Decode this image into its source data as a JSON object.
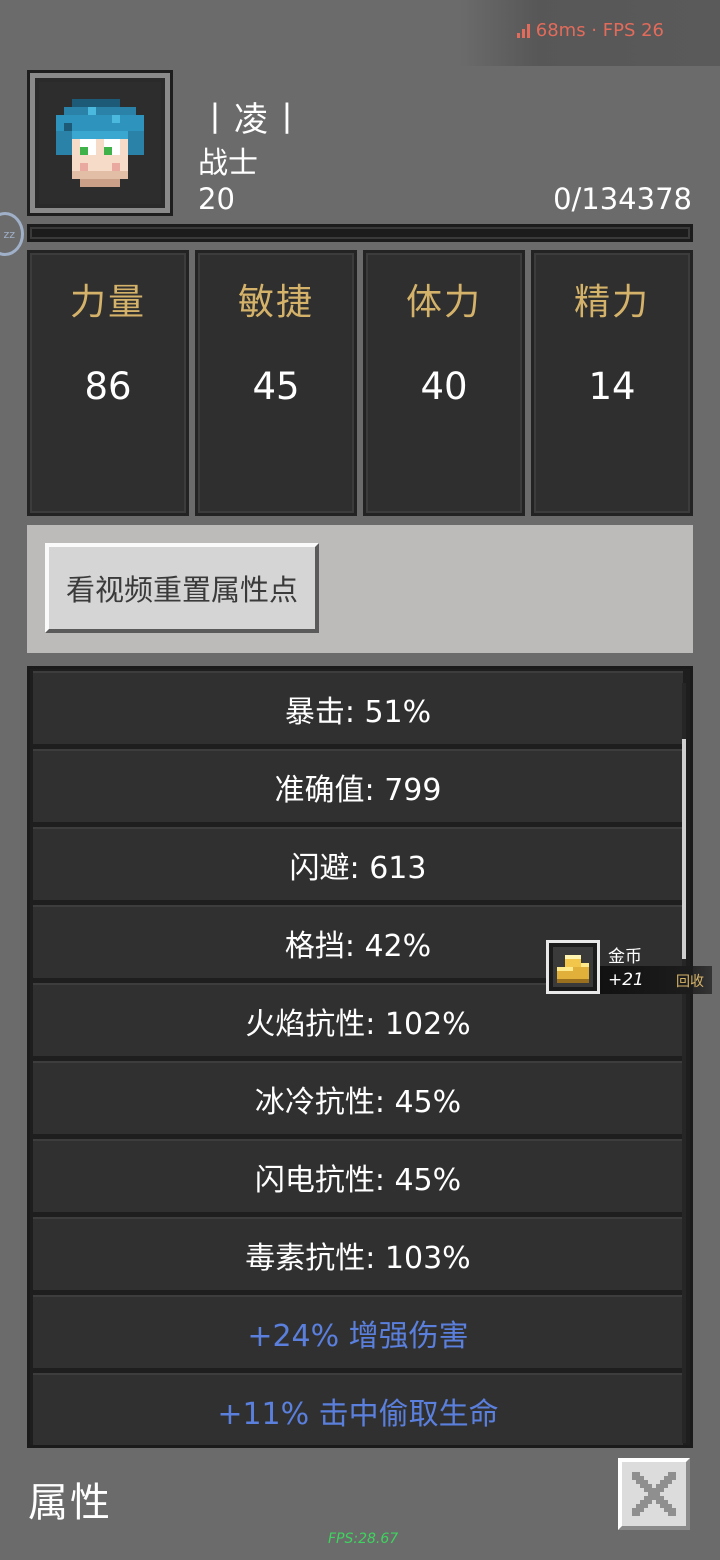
{
  "perf": {
    "text": "68ms · FPS 26",
    "icon": "signal-bars-icon",
    "color": "#e36b5b"
  },
  "character": {
    "name": "丨凌丨",
    "class": "战士",
    "level": "20",
    "exp": "0/134378",
    "exp_progress": 0
  },
  "side_bubble": {
    "text": "zz"
  },
  "stats": [
    {
      "name": "力量",
      "value": "86"
    },
    {
      "name": "敏捷",
      "value": "45"
    },
    {
      "name": "体力",
      "value": "40"
    },
    {
      "name": "精力",
      "value": "14"
    }
  ],
  "reset_button": {
    "label": "看视频重置属性点"
  },
  "attributes": [
    {
      "text": "暴击: 51%",
      "color": "white"
    },
    {
      "text": "准确值: 799",
      "color": "white"
    },
    {
      "text": "闪避: 613",
      "color": "white"
    },
    {
      "text": "格挡: 42%",
      "color": "white"
    },
    {
      "text": "火焰抗性: 102%",
      "color": "white"
    },
    {
      "text": "冰冷抗性: 45%",
      "color": "white"
    },
    {
      "text": "闪电抗性: 45%",
      "color": "white"
    },
    {
      "text": "毒素抗性: 103%",
      "color": "white"
    },
    {
      "text": "+24% 增强伤害",
      "color": "blue"
    },
    {
      "text": "+11% 击中偷取生命",
      "color": "blue"
    }
  ],
  "gold_popup": {
    "title": "金币",
    "amount": "+21",
    "action": "回收",
    "icon": "gold-coins-icon"
  },
  "footer": {
    "title": "属性",
    "close_icon": "close-x-icon",
    "fps": "FPS:28.67"
  },
  "colors": {
    "stat_name": "#d4b26a",
    "blue_text": "#5a7fdc",
    "fps_green": "#3fd35f"
  }
}
